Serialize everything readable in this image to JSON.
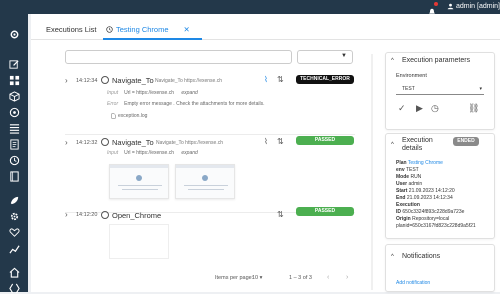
{
  "header": {
    "user_label": "admin [admin]",
    "notification_count": "1"
  },
  "sidebar": {
    "icons": [
      "settings-icon",
      "edit-icon",
      "grid-icon",
      "cube-icon",
      "package-icon",
      "list-icon",
      "document-icon",
      "clock-icon",
      "book-icon",
      "rocket-icon",
      "gear-icon",
      "heart-pulse-icon",
      "chart-icon",
      "home-icon",
      "bracket-icon"
    ]
  },
  "tabs": [
    {
      "label": "Executions List"
    },
    {
      "label": "Testing Chrome",
      "close": "✕"
    }
  ],
  "steps": [
    {
      "time": "14:12:34",
      "title": "Navigate_To",
      "subtitle": "Navigate_To https://exense.ch",
      "input_label": "Input",
      "input_value": "Url = https://exense.ch",
      "expand": "expand",
      "error_label": "Error",
      "error_value": "Empty error message . Check the attachments for more details.",
      "attachment": "exception.log",
      "status": "TECHNICAL_ERROR"
    },
    {
      "time": "14:12:32",
      "title": "Navigate_To",
      "subtitle": "Navigate_To https://exense.ch",
      "input_label": "Input",
      "input_value": "Url = https://exense.ch",
      "expand": "expand",
      "status": "PASSED"
    },
    {
      "time": "14:12:20",
      "title": "Open_Chrome",
      "status": "PASSED"
    }
  ],
  "pager": {
    "items_label": "Items per page:",
    "items_value": "10",
    "range": "1 – 3 of 3"
  },
  "params_panel": {
    "title": "Execution parameters",
    "env_label": "Environment",
    "env_value": "TEST"
  },
  "details_panel": {
    "title_line1": "Execution",
    "title_line2": "details",
    "status": "ENDED",
    "rows": [
      {
        "k": "Plan",
        "v": "Testing Chrome",
        "link": true
      },
      {
        "k": "env",
        "v": "TEST"
      },
      {
        "k": "Mode",
        "v": "RUN"
      },
      {
        "k": "User",
        "v": "admin"
      },
      {
        "k": "Start",
        "v": "21.09.2023 14:12:20"
      },
      {
        "k": "End",
        "v": "21.09.2023 14:12:34"
      },
      {
        "k": "Execution",
        "v": ""
      },
      {
        "k": "ID",
        "v": "650c3324f893c228d9a723e"
      },
      {
        "k": "Origin",
        "v": "Repository=local"
      },
      {
        "k": "",
        "v": "planid=650c3167fd823c228d9a5f21"
      }
    ]
  },
  "notifications_panel": {
    "title": "Notifications",
    "add_label": "Add notification"
  },
  "colors": {
    "sidebar_bg": "#23384a",
    "accent": "#1e88e5",
    "passed": "#4caf50",
    "error": "#111111",
    "ended": "#8a8a8a"
  }
}
